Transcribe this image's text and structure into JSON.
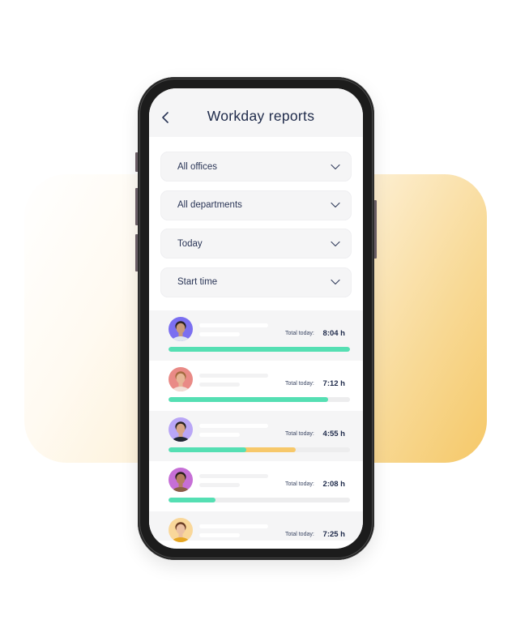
{
  "header": {
    "title": "Workday reports",
    "back_icon": "chevron-left-icon"
  },
  "filters": [
    {
      "label": "All offices",
      "icon": "chevron-down-icon"
    },
    {
      "label": "All departments",
      "icon": "chevron-down-icon"
    },
    {
      "label": "Today",
      "icon": "chevron-down-icon"
    },
    {
      "label": "Start time",
      "icon": "chevron-down-icon"
    }
  ],
  "employees": [
    {
      "avatar_bg": "#7b6ff0",
      "skin": "#c99a7b",
      "hair": "#2b2220",
      "shirt": "#dfe6ef",
      "total_label": "Total today:",
      "total": "8:04 h",
      "worked_pct": 100,
      "extra_pct": 0
    },
    {
      "avatar_bg": "#e98a86",
      "skin": "#e6b596",
      "hair": "#a36a3f",
      "shirt": "#f2ded6",
      "total_label": "Total today:",
      "total": "7:12 h",
      "worked_pct": 88,
      "extra_pct": 0
    },
    {
      "avatar_bg": "#b9a6f6",
      "skin": "#d6a487",
      "hair": "#2a2420",
      "shirt": "#1f2630",
      "total_label": "Total today:",
      "total": "4:55 h",
      "worked_pct": 43,
      "extra_pct": 27
    },
    {
      "avatar_bg": "#c66fd6",
      "skin": "#b47e60",
      "hair": "#2b211c",
      "shirt": "#8a5e45",
      "total_label": "Total today:",
      "total": "2:08 h",
      "worked_pct": 26,
      "extra_pct": 0
    },
    {
      "avatar_bg": "#f9d79a",
      "skin": "#ebc0a3",
      "hair": "#6b3d25",
      "shirt": "#e6a623",
      "total_label": "Total today:",
      "total": "7:25 h",
      "worked_pct": 0,
      "extra_pct": 0
    }
  ],
  "colors": {
    "worked": "#55dfb3",
    "extra": "#f7c86a",
    "track": "#ededee",
    "text_primary": "#1e2a4a"
  }
}
